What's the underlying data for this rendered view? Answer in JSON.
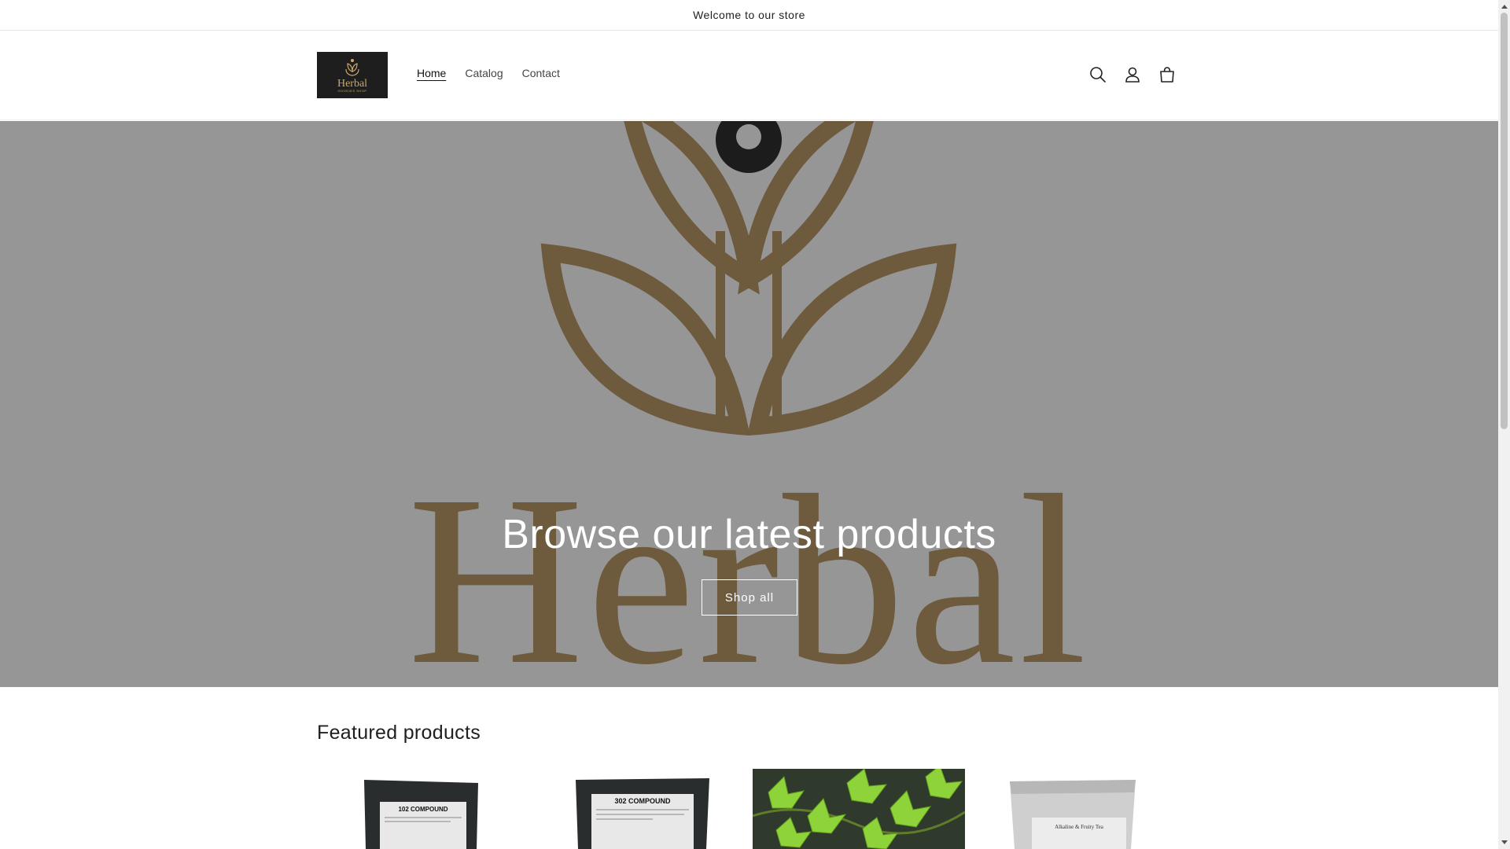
{
  "announcement": {
    "text": "Welcome to our store"
  },
  "header": {
    "logo": {
      "word": "Herbal",
      "subtitle": "GOODIES SHOP"
    },
    "nav": [
      {
        "label": "Home",
        "active": true
      },
      {
        "label": "Catalog",
        "active": false
      },
      {
        "label": "Contact",
        "active": false
      }
    ],
    "icons": [
      "search-icon",
      "account-icon",
      "cart-icon"
    ]
  },
  "hero": {
    "title": "Browse our latest products",
    "button_label": "Shop all",
    "background_word": "Herbal",
    "background_color": "#969696",
    "brand_color": "#6e5a3c"
  },
  "featured": {
    "title": "Featured products",
    "products": [
      {
        "image": "102 COMPOUND"
      },
      {
        "image": "302 COMPOUND"
      },
      {
        "image": "ivy-leaves"
      },
      {
        "image": "Alkaline & Fruity Tea"
      }
    ]
  }
}
